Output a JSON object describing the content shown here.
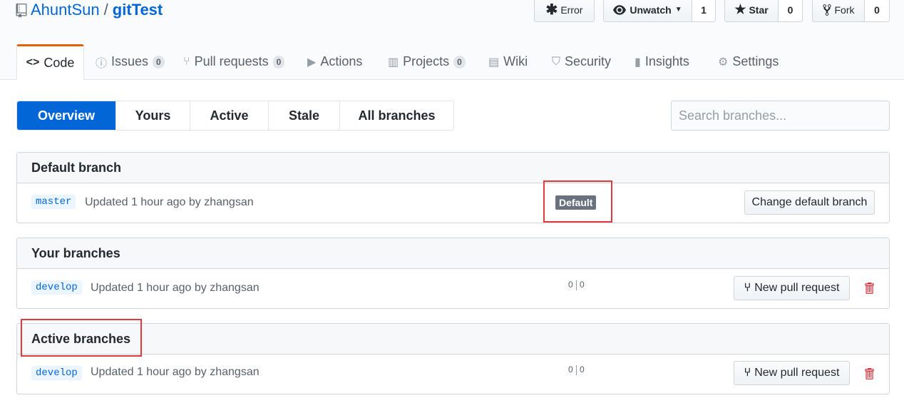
{
  "repo": {
    "owner": "AhuntSun",
    "separator": "/",
    "name": "gitTest"
  },
  "actions": {
    "error_label": "Error",
    "watch_label": "Unwatch",
    "watch_count": "1",
    "star_label": "Star",
    "star_count": "0",
    "fork_label": "Fork",
    "fork_count": "0"
  },
  "tabs": [
    {
      "label": "Code"
    },
    {
      "label": "Issues",
      "count": "0"
    },
    {
      "label": "Pull requests",
      "count": "0"
    },
    {
      "label": "Actions"
    },
    {
      "label": "Projects",
      "count": "0"
    },
    {
      "label": "Wiki"
    },
    {
      "label": "Security"
    },
    {
      "label": "Insights"
    },
    {
      "label": "Settings"
    }
  ],
  "subnav": [
    "Overview",
    "Yours",
    "Active",
    "Stale",
    "All branches"
  ],
  "search": {
    "placeholder": "Search branches..."
  },
  "sections": {
    "default": {
      "title": "Default branch",
      "branch": "master",
      "updated": "Updated 1 hour ago by zhangsan",
      "label": "Default",
      "button": "Change default branch"
    },
    "yours": {
      "title": "Your branches",
      "branch": "develop",
      "updated": "Updated 1 hour ago by zhangsan",
      "behind": "0",
      "ahead": "0",
      "button": "New pull request"
    },
    "active": {
      "title": "Active branches",
      "branch": "develop",
      "updated": "Updated 1 hour ago by zhangsan",
      "behind": "0",
      "ahead": "0",
      "button": "New pull request"
    }
  },
  "colors": {
    "accent": "#0366d6",
    "highlight": "#e03a3e",
    "tab_underline": "#e36209",
    "danger": "#cb2431"
  }
}
